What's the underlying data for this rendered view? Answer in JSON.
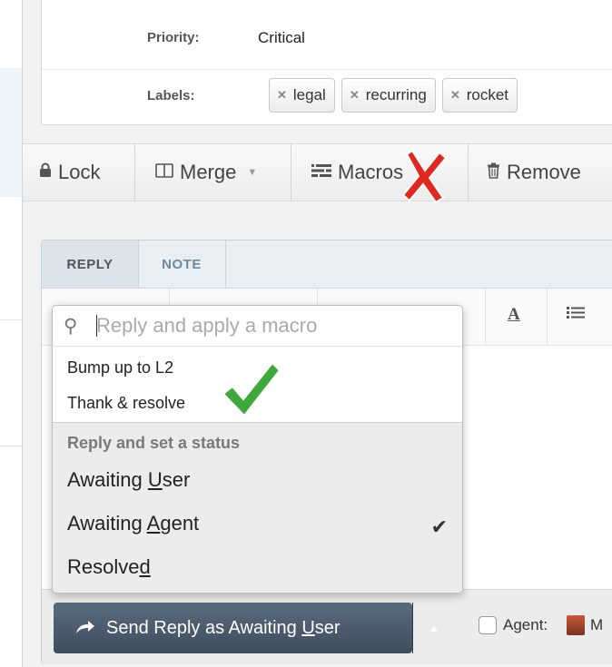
{
  "properties": {
    "priority_label": "Priority:",
    "priority_value": "Critical",
    "labels_label": "Labels:",
    "labels": [
      "legal",
      "recurring",
      "rocket"
    ]
  },
  "toolbar": {
    "lock": "Lock",
    "merge": "Merge",
    "macros": "Macros",
    "remove": "Remove"
  },
  "reply_tabs": [
    "REPLY",
    "NOTE"
  ],
  "macro_dropdown": {
    "search_placeholder": "Reply and apply a macro",
    "macros": [
      "Bump up to L2",
      "Thank & resolve"
    ],
    "status_header": "Reply and set a status",
    "statuses": [
      {
        "pre": "Awaiting ",
        "u": "U",
        "post": "ser",
        "selected": true
      },
      {
        "pre": "Awaiting ",
        "u": "A",
        "post": "gent",
        "selected": false
      },
      {
        "pre": "Resolve",
        "u": "d",
        "post": "",
        "selected": false
      }
    ]
  },
  "footer": {
    "send_pre": "Send Reply as Awaiting ",
    "send_u": "U",
    "send_post": "ser",
    "agent_label": "Agent:",
    "agent_initial": "M"
  },
  "colors": {
    "send_button": "#4b5b6d",
    "note_tab": "#6b8aa3",
    "annotation_red": "#e0281e",
    "annotation_green": "#3fa83a"
  }
}
